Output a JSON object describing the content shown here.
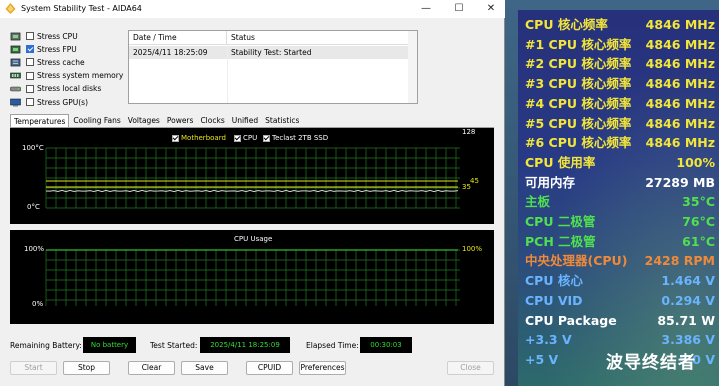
{
  "window": {
    "title": "System Stability Test - AIDA64",
    "controls": {
      "minimize": "—",
      "maximize": "☐",
      "close": "✕"
    }
  },
  "stress_options": [
    {
      "label": "Stress CPU",
      "checked": false,
      "icon": "cpu-icon"
    },
    {
      "label": "Stress FPU",
      "checked": true,
      "icon": "fpu-icon"
    },
    {
      "label": "Stress cache",
      "checked": false,
      "icon": "cache-icon"
    },
    {
      "label": "Stress system memory",
      "checked": false,
      "icon": "memory-icon"
    },
    {
      "label": "Stress local disks",
      "checked": false,
      "icon": "disk-icon"
    },
    {
      "label": "Stress GPU(s)",
      "checked": false,
      "icon": "gpu-icon"
    }
  ],
  "log": {
    "headers": [
      "Date / Time",
      "Status"
    ],
    "rows": [
      {
        "datetime": "2025/4/11 18:25:09",
        "status": "Stability Test: Started"
      }
    ]
  },
  "tabs": [
    "Temperatures",
    "Cooling Fans",
    "Voltages",
    "Powers",
    "Clocks",
    "Unified",
    "Statistics"
  ],
  "active_tab": "Temperatures",
  "temperature_graph": {
    "y_top": "100°C",
    "y_bottom": "0°C",
    "right_top": "128",
    "right_values": [
      "45",
      "35"
    ],
    "legend": [
      "Motherboard",
      "CPU",
      "Teclast 2TB SSD"
    ]
  },
  "usage_graph": {
    "title": "CPU Usage",
    "y_top": "100%",
    "y_bottom": "0%",
    "right_top": "100%"
  },
  "status": {
    "battery_label": "Remaining Battery:",
    "battery_value": "No battery",
    "started_label": "Test Started:",
    "started_value": "2025/4/11 18:25:09",
    "elapsed_label": "Elapsed Time:",
    "elapsed_value": "00:30:03"
  },
  "buttons": {
    "start": "Start",
    "stop": "Stop",
    "clear": "Clear",
    "save": "Save",
    "cpuid": "CPUID",
    "preferences": "Preferences",
    "close": "Close"
  },
  "sensors": [
    {
      "name": "CPU 核心频率",
      "value": "4846 MHz",
      "color": "#f2e63a"
    },
    {
      "name": "#1 CPU 核心频率",
      "value": "4846 MHz",
      "color": "#f2e63a"
    },
    {
      "name": "#2 CPU 核心频率",
      "value": "4846 MHz",
      "color": "#f2e63a"
    },
    {
      "name": "#3 CPU 核心频率",
      "value": "4846 MHz",
      "color": "#f2e63a"
    },
    {
      "name": "#4 CPU 核心频率",
      "value": "4846 MHz",
      "color": "#f2e63a"
    },
    {
      "name": "#5 CPU 核心频率",
      "value": "4846 MHz",
      "color": "#f2e63a"
    },
    {
      "name": "#6 CPU 核心频率",
      "value": "4846 MHz",
      "color": "#f2e63a"
    },
    {
      "name": "CPU 使用率",
      "value": "100%",
      "color": "#f2e63a"
    },
    {
      "name": "可用内存",
      "value": "27289 MB",
      "color": "#ffffff"
    },
    {
      "name": "主板",
      "value": "35°C",
      "color": "#4fe04f"
    },
    {
      "name": "CPU 二极管",
      "value": "76°C",
      "color": "#4fe04f"
    },
    {
      "name": "PCH 二极管",
      "value": "61°C",
      "color": "#4fe04f"
    },
    {
      "name": "中央处理器(CPU)",
      "value": "2428 RPM",
      "color": "#f08a3a"
    },
    {
      "name": "CPU 核心",
      "value": "1.464 V",
      "color": "#6ab4ff"
    },
    {
      "name": "CPU VID",
      "value": "0.294 V",
      "color": "#6ab4ff"
    },
    {
      "name": "CPU Package",
      "value": "85.71 W",
      "color": "#ffffff"
    },
    {
      "name": "+3.3 V",
      "value": "3.386 V",
      "color": "#6ab4ff"
    },
    {
      "name": "+5 V",
      "value": "5.0 V",
      "color": "#6ab4ff"
    }
  ],
  "watermark": "波导终结者"
}
